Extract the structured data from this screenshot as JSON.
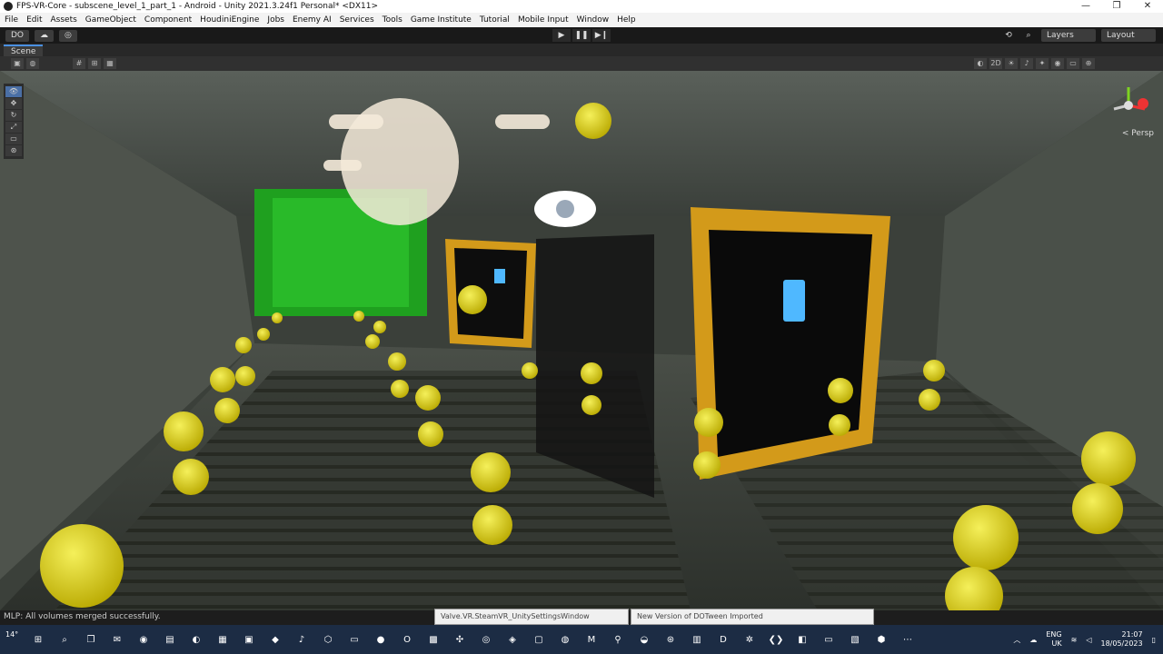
{
  "window": {
    "title": "FPS-VR-Core - subscene_level_1_part_1 - Android - Unity 2021.3.24f1 Personal* <DX11>",
    "controls": [
      "—",
      "❐",
      "✕"
    ]
  },
  "menu": [
    "File",
    "Edit",
    "Assets",
    "GameObject",
    "Component",
    "HoudiniEngine",
    "Jobs",
    "Enemy AI",
    "Services",
    "Tools",
    "Game Institute",
    "Tutorial",
    "Mobile Input",
    "Window",
    "Help"
  ],
  "toolbar": {
    "account": "DO",
    "play": "▶",
    "pause": "❚❚",
    "step": "▶❙",
    "layers": "Layers",
    "layout": "Layout"
  },
  "scene_tab": "Scene",
  "scene_toolbar": {
    "mode_2d": "2D"
  },
  "viewport": {
    "projection": "< Persp"
  },
  "status": "MLP: All volumes merged successfully.",
  "notifications": [
    "Valve.VR.SteamVR_UnitySettingsWindow",
    "New Version of DOTween Imported"
  ],
  "taskbar": {
    "weather": "14°",
    "lang_top": "ENG",
    "lang_bottom": "UK",
    "time": "21:07",
    "date": "18/05/2023"
  },
  "colors": {
    "accent": "#4a90e2",
    "taskbar": "#1c2c44"
  }
}
